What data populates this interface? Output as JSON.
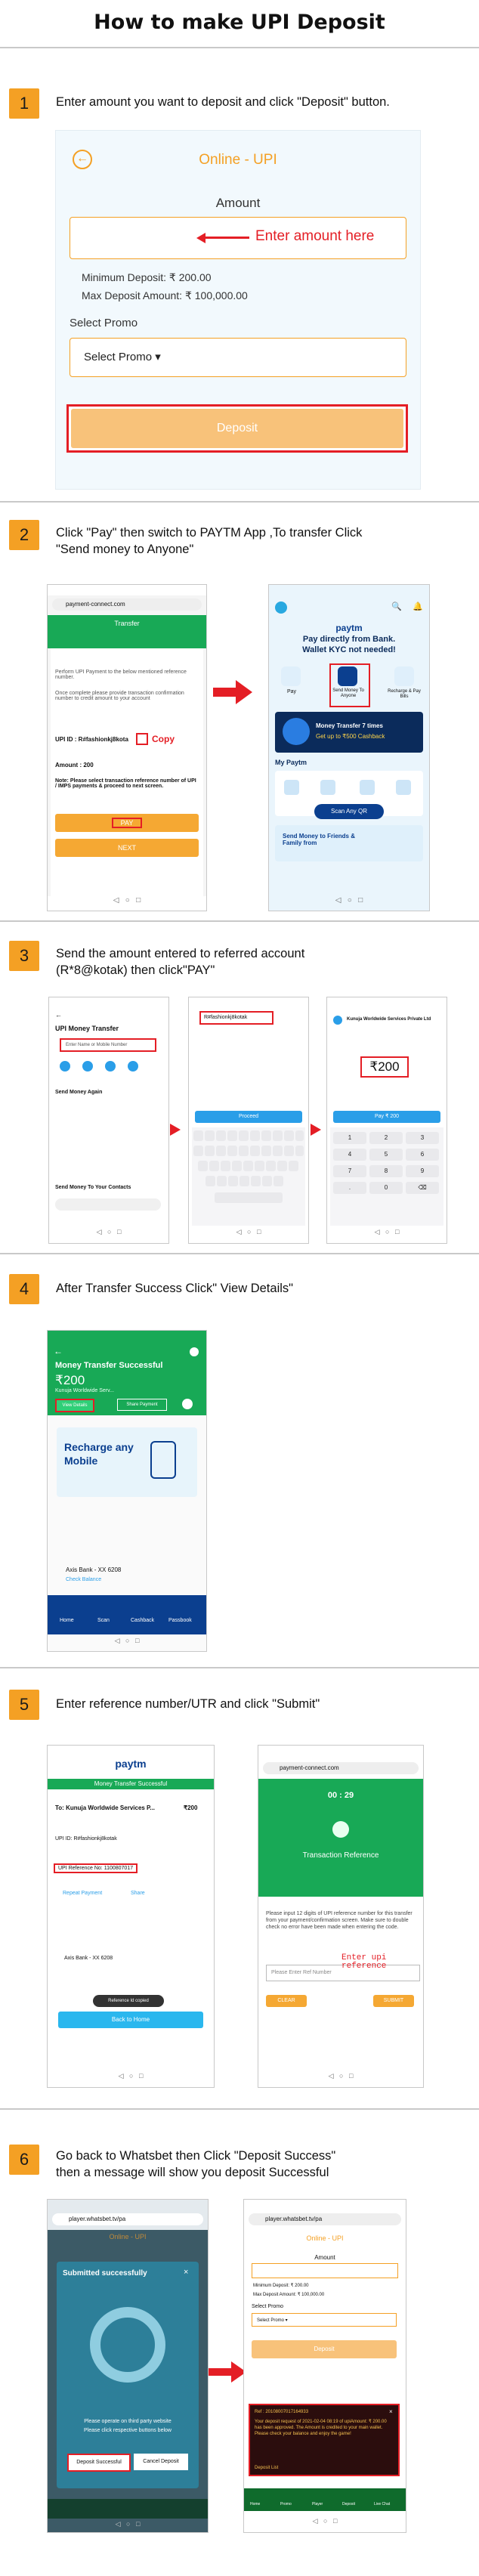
{
  "title": "How to make UPI Deposit",
  "colors": {
    "accent": "#f4a024",
    "red": "#e41e25",
    "paytm_blue": "#0b3f8f",
    "green": "#18a956"
  },
  "steps": [
    {
      "num": "1",
      "text": "Enter amount you want to deposit and click \"Deposit\" button."
    },
    {
      "num": "2",
      "text1": "Click \"Pay\" then switch to  PAYTM App ,To transfer Click",
      "text2": "\"Send money to Anyone\""
    },
    {
      "num": "3",
      "text1": "Send the amount entered to referred account",
      "text2": "(R*8@kotak) then click\"PAY\""
    },
    {
      "num": "4",
      "text": "After Transfer Success Click\" View Details\""
    },
    {
      "num": "5",
      "text": "Enter reference number/UTR and click \"Submit\""
    },
    {
      "num": "6",
      "text1": "Go back to  Whatsbet then Click \"Deposit Success\"",
      "text2": "then a message will show you deposit Successful"
    }
  ],
  "s1": {
    "header": "Online - UPI",
    "back": "back-arrow-icon",
    "amount_label": "Amount",
    "hint": "Enter amount here",
    "min": "Minimum Deposit: ₹ 200.00",
    "max": "Max Deposit Amount: ₹ 100,000.00",
    "select_label": "Select Promo",
    "select_value": "Select Promo ▾",
    "deposit": "Deposit"
  },
  "s2": {
    "url": "payment-connect.com",
    "header": "Transfer",
    "p1": "Perform UPI Payment to the below mentioned reference number.",
    "p2": "Once complete please provide transaction confirmation number to credit amount to your account",
    "upi": "UPI ID : R#fashionkj8kota",
    "copy": "Copy",
    "amount": "Amount : 200",
    "note": "Note: Please select transaction reference number of UPI / IMPS payments & proceed to next screen.",
    "pay": "PAY",
    "next": "NEXT",
    "paytm_logo": "paytm",
    "paytm_head1": "Pay directly from Bank.",
    "paytm_head2": "Wallet KYC not needed!",
    "icons": [
      "Pay",
      "Send Money To Anyone",
      "Recharge & Pay Bills"
    ],
    "promo1": "Money Transfer 7 times",
    "promo2": "Get up to ₹500 Cashback",
    "mypaytm": "My Paytm",
    "scan": "Scan Any QR",
    "send_friends": "Send Money to Friends & Family from"
  },
  "s3": {
    "a_title": "UPI Money Transfer",
    "a_field": "Enter Name or Mobile Number",
    "a_send_again": "Send Money Again",
    "a_contacts": "Send Money To Your Contacts",
    "b_field": "R#fashionkj8kotak",
    "b_proceed": "Proceed",
    "c_name": "Kunuja Worldwide Services Private Ltd",
    "c_amount": "₹200",
    "c_pay": "Pay ₹ 200",
    "keys": [
      "1",
      "2",
      "3",
      "4",
      "5",
      "6",
      "7",
      "8",
      "9",
      ".",
      "0",
      "⌫"
    ]
  },
  "s4": {
    "title": "Money Transfer Successful",
    "amount": "₹200",
    "paid_to": "Kunuja Worldwide Serv...",
    "view": "View Details",
    "share": "Share Payment",
    "recharge1": "Recharge any",
    "recharge2": "Mobile",
    "bank": "Axis Bank - XX 6208",
    "check": "Check Balance",
    "nav": [
      "Home",
      "Scan",
      "Cashback",
      "Passbook"
    ]
  },
  "s5": {
    "paytm": "paytm",
    "bar": "Money Transfer Successful",
    "to": "To: Kunuja Worldwide Services P...",
    "amt": "₹200",
    "upi": "UPI ID: R#fashionkj8kotak",
    "ref": "UPI Reference No: 1100807017",
    "repeat": "Repeat Payment",
    "share": "Share",
    "bank": "Axis Bank - XX 6208",
    "copied": "Reference Id copied",
    "back": "Back to Home",
    "url": "payment-connect.com",
    "timer": "00 : 29",
    "tref": "Transaction Reference",
    "instr": "Please input 12 digits of UPI reference number for this transfer from your payment/confirmation screen. Make sure to double check no error have been made when entering the code.",
    "input_ph": "Please Enter Ref Number",
    "handwrite": "Enter upi reference",
    "clear": "CLEAR",
    "submit": "SUBMIT"
  },
  "s6": {
    "url": "player.whatsbet.tv/pa",
    "header": "Online - UPI",
    "modal_title": "Submitted successfully",
    "modal_text1": "Please operate on third party website",
    "modal_text2": "Please click respective buttons below",
    "deposit_success": "Deposit Successful",
    "cancel": "Cancel Deposit",
    "right_url": "player.whatsbet.tv/pa",
    "right_header": "Online - UPI",
    "amount": "Amount",
    "min": "Minimum Deposit: ₹ 200.00",
    "max": "Max Deposit Amount: ₹ 100,000.00",
    "promo": "Select Promo",
    "promo_val": "Select Promo ▾",
    "deposit": "Deposit",
    "msg_ref": "Ref : 20108007017164933",
    "msg": "Your deposit request of 2021-02-04 08:19 of upiAmount: ₹ 200.00 has been approved. The Amount is credited to your main wallet. Please check your balance and enjoy the game!",
    "list": "Deposit List",
    "nav": [
      "Home",
      "Promo",
      "Player",
      "Deposit",
      "Live Chat"
    ]
  }
}
